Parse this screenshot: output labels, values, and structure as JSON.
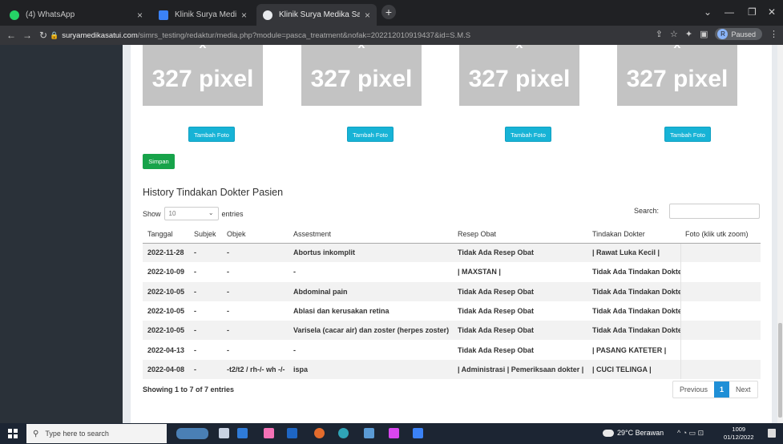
{
  "browser": {
    "tabs": [
      {
        "label": "(4) WhatsApp",
        "color": "#25d366"
      },
      {
        "label": "Klinik Surya Medika Satui",
        "color": "#3b82f6"
      },
      {
        "label": "Klinik Surya Medika Satui",
        "color": "#e8eaed"
      }
    ],
    "new_tab": "+",
    "url_host": "suryamedikasatui.com",
    "url_path": "/simrs_testing/redaktur/media.php?module=pasca_treatment&nofak=202212010919437&id=S.M.S",
    "profile_initial": "R",
    "profile_status": "Paused"
  },
  "photos": {
    "placeholder_text": "327 pixel",
    "add_photo_label": "Tambah Foto",
    "save_label": "Simpan"
  },
  "history": {
    "title": "History Tindakan Dokter Pasien",
    "show_label": "Show",
    "entries_value": "10",
    "entries_label": "entries",
    "search_label": "Search:",
    "columns": [
      "Tanggal",
      "Subjek",
      "Objek",
      "Assestment",
      "Resep Obat",
      "Tindakan Dokter",
      "Foto (klik utk zoom)"
    ],
    "rows": [
      [
        "2022-11-28",
        "-",
        "-",
        "Abortus inkomplit",
        "Tidak Ada Resep Obat",
        "| Rawat Luka Kecil |",
        ""
      ],
      [
        "2022-10-09",
        "-",
        "-",
        "-",
        "| MAXSTAN |",
        "Tidak Ada Tindakan Dokter",
        ""
      ],
      [
        "2022-10-05",
        "-",
        "-",
        "Abdominal pain",
        "Tidak Ada Resep Obat",
        "Tidak Ada Tindakan Dokter",
        ""
      ],
      [
        "2022-10-05",
        "-",
        "-",
        "Ablasi dan kerusakan retina",
        "Tidak Ada Resep Obat",
        "Tidak Ada Tindakan Dokter",
        ""
      ],
      [
        "2022-10-05",
        "-",
        "-",
        "Varisela (cacar air) dan zoster (herpes zoster)",
        "Tidak Ada Resep Obat",
        "Tidak Ada Tindakan Dokter",
        ""
      ],
      [
        "2022-04-13",
        "-",
        "-",
        "-",
        "Tidak Ada Resep Obat",
        "| PASANG KATETER |",
        ""
      ],
      [
        "2022-04-08",
        "-",
        "-t2/t2 / rh-/- wh -/-",
        "ispa",
        "| Administrasi | Pemeriksaan dokter |",
        "| CUCI TELINGA |",
        ""
      ]
    ],
    "info": "Showing 1 to 7 of 7 entries",
    "pager": {
      "previous": "Previous",
      "current": "1",
      "next": "Next"
    }
  },
  "taskbar": {
    "search_placeholder": "Type here to search",
    "weather": "29°C Berawan",
    "time": "1009",
    "date": "01/12/2022"
  }
}
